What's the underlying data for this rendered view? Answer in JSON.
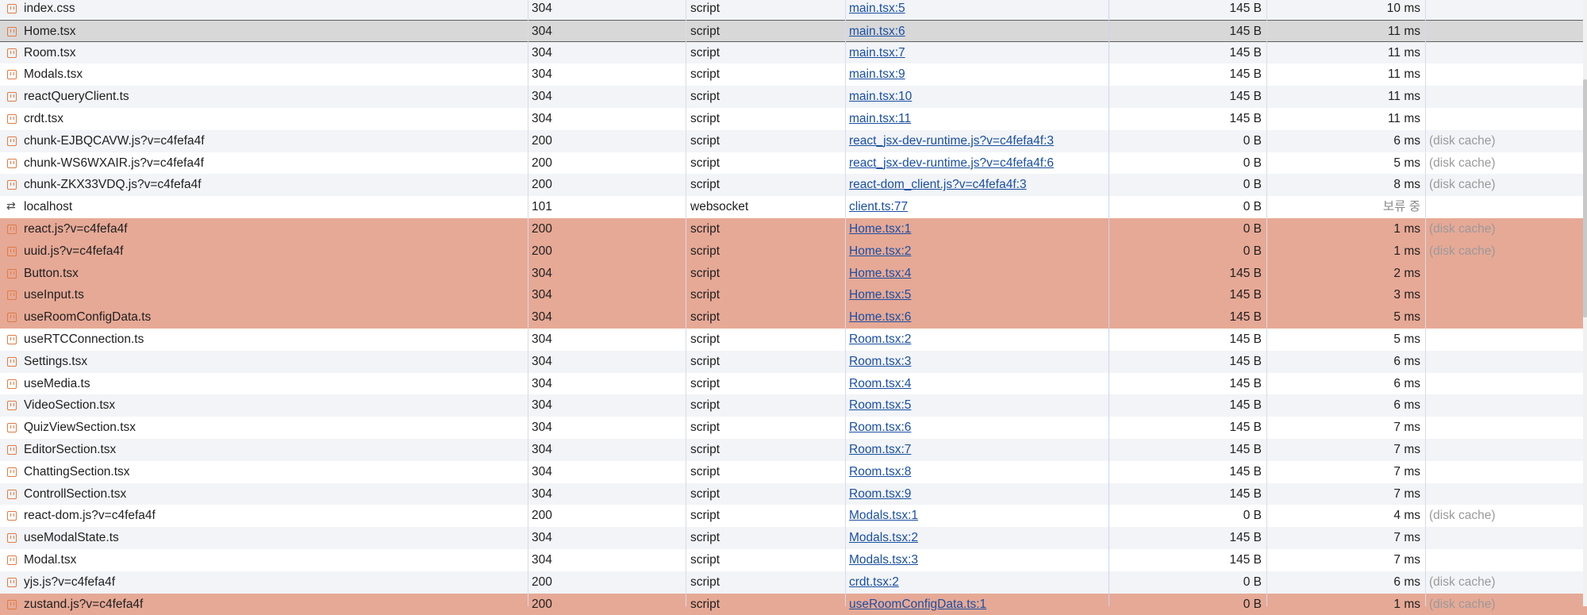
{
  "requests": [
    {
      "name": "index.css",
      "status": "304",
      "type": "script",
      "initiator": "main.tsx:5",
      "size": "145 B",
      "time": "10 ms",
      "note": "",
      "icon": "script-file-icon",
      "state": "normal"
    },
    {
      "name": "Home.tsx",
      "status": "304",
      "type": "script",
      "initiator": "main.tsx:6",
      "size": "145 B",
      "time": "11 ms",
      "note": "",
      "icon": "script-file-icon",
      "state": "selected"
    },
    {
      "name": "Room.tsx",
      "status": "304",
      "type": "script",
      "initiator": "main.tsx:7",
      "size": "145 B",
      "time": "11 ms",
      "note": "",
      "icon": "script-file-icon",
      "state": "normal"
    },
    {
      "name": "Modals.tsx",
      "status": "304",
      "type": "script",
      "initiator": "main.tsx:9",
      "size": "145 B",
      "time": "11 ms",
      "note": "",
      "icon": "script-file-icon",
      "state": "normal"
    },
    {
      "name": "reactQueryClient.ts",
      "status": "304",
      "type": "script",
      "initiator": "main.tsx:10",
      "size": "145 B",
      "time": "11 ms",
      "note": "",
      "icon": "script-file-icon",
      "state": "normal"
    },
    {
      "name": "crdt.tsx",
      "status": "304",
      "type": "script",
      "initiator": "main.tsx:11",
      "size": "145 B",
      "time": "11 ms",
      "note": "",
      "icon": "script-file-icon",
      "state": "normal"
    },
    {
      "name": "chunk-EJBQCAVW.js?v=c4fefa4f",
      "status": "200",
      "type": "script",
      "initiator": "react_jsx-dev-runtime.js?v=c4fefa4f:3",
      "size": "0 B",
      "time": "6 ms",
      "note": "(disk cache)",
      "icon": "script-file-icon",
      "state": "normal"
    },
    {
      "name": "chunk-WS6WXAIR.js?v=c4fefa4f",
      "status": "200",
      "type": "script",
      "initiator": "react_jsx-dev-runtime.js?v=c4fefa4f:6",
      "size": "0 B",
      "time": "5 ms",
      "note": "(disk cache)",
      "icon": "script-file-icon",
      "state": "normal"
    },
    {
      "name": "chunk-ZKX33VDQ.js?v=c4fefa4f",
      "status": "200",
      "type": "script",
      "initiator": "react-dom_client.js?v=c4fefa4f:3",
      "size": "0 B",
      "time": "8 ms",
      "note": "(disk cache)",
      "icon": "script-file-icon",
      "state": "normal"
    },
    {
      "name": "localhost",
      "status": "101",
      "type": "websocket",
      "initiator": "client.ts:77",
      "size": "0 B",
      "time": "보류 중",
      "note": "",
      "icon": "websocket-arrows-icon",
      "state": "normal"
    },
    {
      "name": "react.js?v=c4fefa4f",
      "status": "200",
      "type": "script",
      "initiator": "Home.tsx:1",
      "size": "0 B",
      "time": "1 ms",
      "note": "(disk cache)",
      "icon": "script-file-icon",
      "state": "highlight"
    },
    {
      "name": "uuid.js?v=c4fefa4f",
      "status": "200",
      "type": "script",
      "initiator": "Home.tsx:2",
      "size": "0 B",
      "time": "1 ms",
      "note": "(disk cache)",
      "icon": "script-file-icon",
      "state": "highlight"
    },
    {
      "name": "Button.tsx",
      "status": "304",
      "type": "script",
      "initiator": "Home.tsx:4",
      "size": "145 B",
      "time": "2 ms",
      "note": "",
      "icon": "script-file-icon",
      "state": "highlight"
    },
    {
      "name": "useInput.ts",
      "status": "304",
      "type": "script",
      "initiator": "Home.tsx:5",
      "size": "145 B",
      "time": "3 ms",
      "note": "",
      "icon": "script-file-icon",
      "state": "highlight"
    },
    {
      "name": "useRoomConfigData.ts",
      "status": "304",
      "type": "script",
      "initiator": "Home.tsx:6",
      "size": "145 B",
      "time": "5 ms",
      "note": "",
      "icon": "script-file-icon",
      "state": "highlight"
    },
    {
      "name": "useRTCConnection.ts",
      "status": "304",
      "type": "script",
      "initiator": "Room.tsx:2",
      "size": "145 B",
      "time": "5 ms",
      "note": "",
      "icon": "script-file-icon",
      "state": "normal"
    },
    {
      "name": "Settings.tsx",
      "status": "304",
      "type": "script",
      "initiator": "Room.tsx:3",
      "size": "145 B",
      "time": "6 ms",
      "note": "",
      "icon": "script-file-icon",
      "state": "normal"
    },
    {
      "name": "useMedia.ts",
      "status": "304",
      "type": "script",
      "initiator": "Room.tsx:4",
      "size": "145 B",
      "time": "6 ms",
      "note": "",
      "icon": "script-file-icon",
      "state": "normal"
    },
    {
      "name": "VideoSection.tsx",
      "status": "304",
      "type": "script",
      "initiator": "Room.tsx:5",
      "size": "145 B",
      "time": "6 ms",
      "note": "",
      "icon": "script-file-icon",
      "state": "normal"
    },
    {
      "name": "QuizViewSection.tsx",
      "status": "304",
      "type": "script",
      "initiator": "Room.tsx:6",
      "size": "145 B",
      "time": "7 ms",
      "note": "",
      "icon": "script-file-icon",
      "state": "normal"
    },
    {
      "name": "EditorSection.tsx",
      "status": "304",
      "type": "script",
      "initiator": "Room.tsx:7",
      "size": "145 B",
      "time": "7 ms",
      "note": "",
      "icon": "script-file-icon",
      "state": "normal"
    },
    {
      "name": "ChattingSection.tsx",
      "status": "304",
      "type": "script",
      "initiator": "Room.tsx:8",
      "size": "145 B",
      "time": "7 ms",
      "note": "",
      "icon": "script-file-icon",
      "state": "normal"
    },
    {
      "name": "ControllSection.tsx",
      "status": "304",
      "type": "script",
      "initiator": "Room.tsx:9",
      "size": "145 B",
      "time": "7 ms",
      "note": "",
      "icon": "script-file-icon",
      "state": "normal"
    },
    {
      "name": "react-dom.js?v=c4fefa4f",
      "status": "200",
      "type": "script",
      "initiator": "Modals.tsx:1",
      "size": "0 B",
      "time": "4 ms",
      "note": "(disk cache)",
      "icon": "script-file-icon",
      "state": "normal"
    },
    {
      "name": "useModalState.ts",
      "status": "304",
      "type": "script",
      "initiator": "Modals.tsx:2",
      "size": "145 B",
      "time": "7 ms",
      "note": "",
      "icon": "script-file-icon",
      "state": "normal"
    },
    {
      "name": "Modal.tsx",
      "status": "304",
      "type": "script",
      "initiator": "Modals.tsx:3",
      "size": "145 B",
      "time": "7 ms",
      "note": "",
      "icon": "script-file-icon",
      "state": "normal"
    },
    {
      "name": "yjs.js?v=c4fefa4f",
      "status": "200",
      "type": "script",
      "initiator": "crdt.tsx:2",
      "size": "0 B",
      "time": "6 ms",
      "note": "(disk cache)",
      "icon": "script-file-icon",
      "state": "normal"
    },
    {
      "name": "zustand.js?v=c4fefa4f",
      "status": "200",
      "type": "script",
      "initiator": "useRoomConfigData.ts:1",
      "size": "0 B",
      "time": "1 ms",
      "note": "(disk cache)",
      "icon": "script-file-icon",
      "state": "highlight"
    }
  ],
  "colors": {
    "highlight_row": "#e6a996",
    "selected_row": "#d8d8d8",
    "alt_row": "#f2f4f7",
    "link": "#1a4fa3",
    "icon_accent": "#e07b43",
    "muted_text": "#9a9a9a"
  }
}
